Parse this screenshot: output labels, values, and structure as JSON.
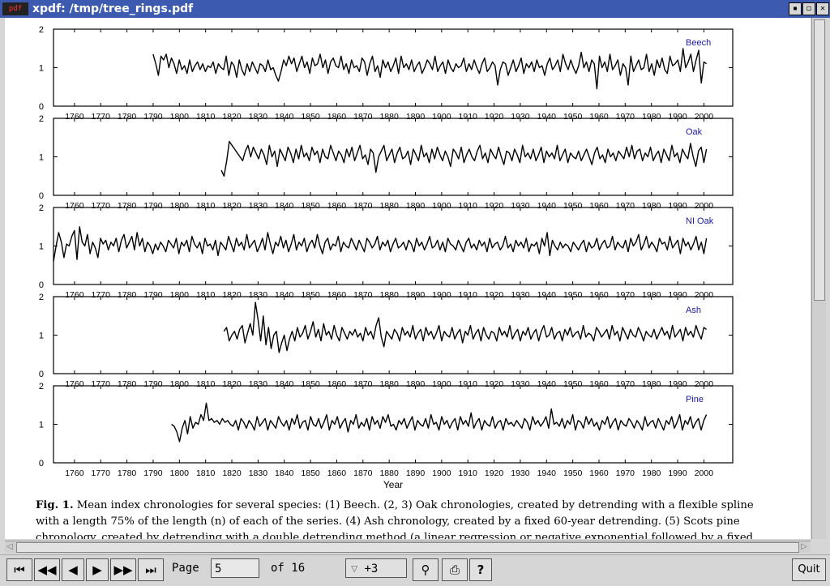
{
  "window": {
    "title": "xpdf: /tmp/tree_rings.pdf",
    "app_icon": "pdf",
    "buttons": [
      "iconify-icon",
      "maximize-icon",
      "close-icon"
    ]
  },
  "document": {
    "caption_lines": [
      "Mean index chronologies for several species: (1) Beech. (2, 3) Oak chronologies, created by detrending with a flexible spline",
      "with a length 75% of the length (n) of each of the series. (4) Ash chronology, created by a fixed 60-year detrending. (5) Scots pine",
      "chronology, created by detrending with a double detrending method (a linear regression or negative exponential followed by a fixed"
    ],
    "caption_label": "Fig. 1."
  },
  "chart_data": {
    "type": "line",
    "xlabel": "Year",
    "x_ticks": [
      1760,
      1770,
      1780,
      1790,
      1800,
      1810,
      1820,
      1830,
      1840,
      1850,
      1860,
      1870,
      1880,
      1890,
      1900,
      1910,
      1920,
      1930,
      1940,
      1950,
      1960,
      1970,
      1980,
      1990,
      2000
    ],
    "y_ticks": [
      0,
      1,
      2
    ],
    "xlim": [
      1752,
      2011
    ],
    "ylim": [
      0,
      2
    ],
    "panels": [
      {
        "name": "Beech",
        "start": 1790,
        "end": 2001,
        "values": [
          1.35,
          1.1,
          0.8,
          1.3,
          1.2,
          1.35,
          1.0,
          1.25,
          1.1,
          0.85,
          1.2,
          0.95,
          1.05,
          0.85,
          1.2,
          0.9,
          1.05,
          1.15,
          0.95,
          1.1,
          0.9,
          1.05,
          1.0,
          1.15,
          0.85,
          1.1,
          1.0,
          0.95,
          1.3,
          0.8,
          1.15,
          1.05,
          0.75,
          1.2,
          0.95,
          0.8,
          1.1,
          0.9,
          1.15,
          1.0,
          0.85,
          1.1,
          1.05,
          0.9,
          1.2,
          0.95,
          1.0,
          0.8,
          0.65,
          0.9,
          1.2,
          1.05,
          1.3,
          1.1,
          1.25,
          0.9,
          1.1,
          1.3,
          1.0,
          1.15,
          0.85,
          1.25,
          1.05,
          1.1,
          1.35,
          1.0,
          1.2,
          0.85,
          1.15,
          1.25,
          1.05,
          1.0,
          1.3,
          0.95,
          1.1,
          0.85,
          1.2,
          1.0,
          1.05,
          0.9,
          1.25,
          1.15,
          0.8,
          1.1,
          1.3,
          0.9,
          1.05,
          0.75,
          1.2,
          1.0,
          1.15,
          0.9,
          1.05,
          1.25,
          0.85,
          1.3,
          1.0,
          1.1,
          0.95,
          1.2,
          0.9,
          1.05,
          1.15,
          0.85,
          1.0,
          1.2,
          1.1,
          0.95,
          1.3,
          0.9,
          1.05,
          1.15,
          0.85,
          1.2,
          1.0,
          0.9,
          1.1,
          1.0,
          1.05,
          1.25,
          0.9,
          1.1,
          0.95,
          1.2,
          1.0,
          0.85,
          1.1,
          1.25,
          0.9,
          1.0,
          1.15,
          1.05,
          0.55,
          0.95,
          1.15,
          1.1,
          0.8,
          1.0,
          1.2,
          0.9,
          1.05,
          1.25,
          0.85,
          1.1,
          1.0,
          1.15,
          0.9,
          1.2,
          1.0,
          1.05,
          0.8,
          1.1,
          1.25,
          0.95,
          1.05,
          1.2,
          0.9,
          1.35,
          1.1,
          0.95,
          1.2,
          1.0,
          0.85,
          1.05,
          1.4,
          1.0,
          1.15,
          0.9,
          1.2,
          1.1,
          0.45,
          1.3,
          1.0,
          1.15,
          0.9,
          1.35,
          0.95,
          1.05,
          1.2,
          0.8,
          1.1,
          1.0,
          0.55,
          1.3,
          0.9,
          1.05,
          1.2,
          0.95,
          1.0,
          1.35,
          0.9,
          1.1,
          0.8,
          1.2,
          1.0,
          1.25,
          0.95,
          0.85,
          1.3,
          1.05,
          1.1,
          1.2,
          0.9,
          1.5,
          1.0,
          1.15,
          1.35,
          0.9,
          1.2,
          1.45,
          0.6,
          1.15,
          1.1
        ]
      },
      {
        "name": "Oak",
        "start": 1816,
        "end": 2001,
        "values": [
          0.65,
          0.5,
          0.9,
          1.4,
          1.3,
          1.2,
          1.1,
          1.0,
          0.9,
          1.15,
          1.3,
          1.0,
          1.25,
          1.1,
          0.95,
          1.2,
          1.05,
          0.8,
          1.3,
          1.0,
          1.15,
          0.75,
          1.2,
          1.05,
          0.9,
          1.25,
          1.1,
          0.85,
          1.2,
          0.95,
          1.3,
          1.0,
          1.1,
          0.9,
          1.25,
          1.05,
          1.15,
          0.85,
          1.2,
          1.0,
          0.95,
          1.3,
          1.1,
          0.9,
          1.15,
          1.05,
          0.85,
          1.2,
          1.0,
          1.25,
          0.9,
          1.1,
          1.3,
          0.95,
          1.05,
          0.8,
          1.2,
          1.1,
          0.6,
          1.0,
          1.15,
          1.3,
          0.9,
          1.05,
          1.2,
          0.85,
          1.1,
          1.25,
          0.95,
          1.0,
          1.15,
          0.8,
          1.2,
          1.05,
          0.9,
          1.3,
          1.0,
          1.1,
          0.85,
          1.2,
          0.95,
          1.25,
          1.05,
          0.9,
          1.15,
          1.0,
          0.75,
          1.2,
          1.1,
          0.95,
          1.25,
          0.85,
          1.05,
          1.2,
          1.0,
          0.9,
          1.15,
          1.3,
          0.95,
          1.1,
          0.85,
          1.2,
          1.05,
          0.95,
          1.25,
          1.0,
          0.8,
          1.15,
          1.1,
          0.9,
          1.2,
          1.05,
          0.85,
          1.3,
          1.0,
          1.1,
          0.95,
          1.2,
          0.9,
          1.05,
          1.25,
          0.85,
          1.15,
          1.0,
          1.1,
          0.95,
          1.3,
          0.9,
          1.05,
          1.2,
          0.85,
          1.1,
          1.0,
          0.95,
          1.15,
          0.9,
          1.05,
          1.2,
          1.0,
          0.8,
          1.1,
          1.25,
          0.95,
          1.05,
          0.85,
          1.2,
          1.0,
          1.1,
          0.9,
          1.15,
          1.05,
          0.95,
          1.25,
          1.0,
          1.3,
          0.95,
          1.15,
          1.2,
          0.9,
          1.1,
          1.0,
          1.25,
          0.9,
          1.05,
          1.15,
          0.85,
          1.2,
          1.05,
          0.9,
          1.3,
          1.0,
          1.1,
          0.85,
          1.2,
          1.05,
          0.95,
          1.35,
          1.0,
          0.75,
          1.15,
          1.25,
          0.85,
          1.2
        ]
      },
      {
        "name": "NI Oak",
        "start": 1752,
        "end": 2001,
        "values": [
          0.6,
          1.0,
          1.35,
          1.1,
          0.7,
          1.05,
          1.0,
          1.25,
          1.4,
          0.65,
          1.5,
          1.1,
          1.0,
          1.3,
          0.8,
          1.1,
          0.95,
          0.7,
          1.2,
          1.05,
          1.15,
          0.9,
          1.1,
          1.0,
          1.2,
          0.85,
          1.15,
          1.3,
          0.95,
          1.1,
          1.25,
          0.9,
          1.35,
          1.0,
          1.2,
          0.85,
          1.1,
          1.0,
          0.8,
          1.05,
          0.9,
          1.1,
          1.0,
          0.85,
          1.15,
          1.05,
          0.95,
          1.2,
          0.8,
          1.1,
          1.0,
          1.15,
          0.85,
          1.25,
          1.05,
          0.95,
          1.1,
          0.8,
          1.2,
          1.0,
          1.05,
          0.9,
          1.15,
          0.75,
          1.1,
          1.0,
          0.9,
          1.25,
          1.05,
          0.85,
          1.2,
          1.0,
          1.1,
          0.9,
          1.3,
          0.95,
          1.05,
          1.15,
          0.85,
          1.0,
          1.2,
          0.9,
          1.35,
          1.05,
          0.8,
          1.1,
          1.0,
          1.25,
          0.95,
          1.15,
          0.85,
          1.05,
          1.3,
          0.9,
          1.1,
          1.0,
          1.2,
          0.85,
          1.05,
          1.15,
          0.95,
          1.3,
          1.0,
          0.8,
          1.1,
          1.2,
          0.9,
          1.05,
          1.0,
          1.25,
          0.85,
          1.1,
          1.0,
          0.95,
          1.2,
          1.05,
          0.9,
          1.15,
          1.0,
          0.85,
          1.2,
          1.1,
          0.95,
          1.05,
          1.25,
          0.9,
          1.1,
          1.0,
          1.15,
          0.85,
          1.05,
          1.2,
          0.95,
          1.0,
          1.1,
          0.9,
          1.15,
          1.05,
          0.85,
          1.2,
          1.0,
          1.1,
          0.9,
          1.05,
          1.25,
          0.95,
          1.0,
          1.15,
          0.9,
          1.1,
          0.85,
          1.2,
          1.05,
          1.0,
          0.9,
          1.15,
          1.0,
          0.85,
          1.1,
          1.2,
          0.95,
          1.05,
          0.9,
          1.15,
          1.0,
          1.1,
          0.85,
          1.2,
          0.95,
          1.05,
          1.1,
          0.9,
          1.0,
          1.25,
          0.95,
          1.05,
          0.85,
          1.15,
          1.0,
          1.1,
          0.95,
          1.2,
          0.85,
          1.05,
          1.0,
          1.1,
          0.8,
          1.2,
          1.0,
          1.35,
          0.75,
          1.15,
          1.0,
          0.9,
          1.1,
          0.95,
          1.05,
          1.0,
          0.85,
          1.1,
          1.0,
          0.9,
          1.05,
          1.15,
          0.85,
          1.1,
          0.95,
          1.0,
          1.2,
          0.9,
          1.05,
          1.15,
          0.95,
          1.0,
          1.25,
          0.9,
          1.1,
          1.0,
          0.95,
          1.15,
          0.85,
          1.2,
          1.0,
          1.1,
          1.3,
          0.9,
          1.05,
          1.25,
          0.95,
          1.1,
          1.0,
          0.85,
          1.2,
          1.05,
          1.1,
          0.9,
          1.25,
          0.95,
          1.05,
          1.15,
          0.8,
          1.2,
          1.0,
          1.1,
          0.9,
          1.05,
          1.25,
          0.9,
          1.1,
          0.8,
          1.2
        ]
      },
      {
        "name": "Ash",
        "start": 1817,
        "end": 2001,
        "values": [
          1.1,
          1.2,
          0.85,
          1.0,
          1.1,
          0.9,
          1.15,
          1.25,
          0.8,
          1.05,
          1.3,
          1.0,
          1.85,
          1.4,
          0.85,
          1.5,
          0.75,
          1.2,
          0.65,
          1.0,
          1.1,
          0.55,
          0.8,
          1.0,
          0.6,
          0.9,
          1.1,
          0.85,
          1.2,
          0.95,
          1.05,
          1.25,
          0.9,
          1.1,
          1.35,
          0.95,
          1.15,
          0.85,
          1.3,
          1.0,
          1.1,
          0.9,
          1.25,
          1.0,
          0.85,
          1.2,
          1.05,
          0.9,
          1.1,
          1.0,
          1.15,
          0.95,
          1.05,
          0.85,
          1.2,
          1.0,
          1.1,
          0.9,
          1.25,
          1.45,
          0.95,
          0.7,
          1.1,
          1.0,
          0.9,
          1.15,
          1.05,
          0.85,
          1.2,
          1.0,
          1.1,
          0.95,
          1.25,
          0.9,
          1.05,
          1.15,
          0.85,
          1.2,
          1.0,
          1.1,
          0.9,
          1.05,
          1.25,
          0.85,
          1.1,
          1.0,
          0.95,
          1.2,
          0.9,
          1.05,
          1.15,
          0.8,
          1.1,
          1.0,
          1.25,
          0.9,
          1.05,
          1.15,
          0.85,
          1.2,
          1.0,
          0.9,
          1.1,
          1.05,
          0.85,
          1.2,
          1.0,
          1.1,
          0.95,
          1.25,
          0.9,
          1.05,
          1.15,
          0.85,
          1.1,
          1.0,
          1.2,
          0.9,
          1.05,
          1.15,
          0.85,
          1.1,
          1.25,
          0.95,
          1.0,
          1.2,
          0.9,
          1.05,
          1.1,
          0.85,
          1.15,
          1.0,
          1.2,
          0.95,
          1.05,
          1.1,
          0.9,
          1.25,
          0.95,
          1.05,
          1.0,
          0.85,
          1.2,
          1.1,
          0.95,
          1.05,
          1.15,
          0.9,
          1.25,
          1.0,
          1.1,
          0.85,
          1.2,
          1.05,
          0.9,
          1.15,
          1.0,
          0.95,
          1.2,
          1.05,
          0.85,
          1.1,
          1.0,
          0.95,
          1.15,
          0.9,
          1.05,
          1.2,
          1.0,
          1.1,
          0.9,
          1.25,
          0.95,
          1.05,
          1.15,
          0.85,
          1.2,
          1.0,
          1.1,
          0.95,
          1.25,
          1.05,
          0.9,
          1.2,
          1.15
        ]
      },
      {
        "name": "Pine",
        "start": 1797,
        "end": 2001,
        "values": [
          1.0,
          0.95,
          0.8,
          0.55,
          0.9,
          1.1,
          0.75,
          1.2,
          0.9,
          1.05,
          1.0,
          1.25,
          1.1,
          1.55,
          1.1,
          1.15,
          1.05,
          1.1,
          1.0,
          1.15,
          1.05,
          1.1,
          1.0,
          0.95,
          1.1,
          0.85,
          1.15,
          1.05,
          0.9,
          1.1,
          1.0,
          0.85,
          1.2,
          0.95,
          1.05,
          1.15,
          0.85,
          1.1,
          1.0,
          0.9,
          1.2,
          1.05,
          0.95,
          1.1,
          0.85,
          1.15,
          1.0,
          1.25,
          0.9,
          1.05,
          1.1,
          0.85,
          1.2,
          1.0,
          0.95,
          1.15,
          0.9,
          1.05,
          1.25,
          0.85,
          1.1,
          1.0,
          1.2,
          0.9,
          1.05,
          1.15,
          0.8,
          1.1,
          1.0,
          1.25,
          0.9,
          1.05,
          0.95,
          1.15,
          0.85,
          1.2,
          1.0,
          1.1,
          0.9,
          1.2,
          1.05,
          1.25,
          0.95,
          1.0,
          0.85,
          1.1,
          1.0,
          1.15,
          0.9,
          1.05,
          1.2,
          0.85,
          1.1,
          1.0,
          0.95,
          1.15,
          0.9,
          1.25,
          1.0,
          1.05,
          0.85,
          1.2,
          1.0,
          1.1,
          0.9,
          1.05,
          1.15,
          0.85,
          1.2,
          1.0,
          1.1,
          0.95,
          1.3,
          0.9,
          1.05,
          1.15,
          0.85,
          1.1,
          1.0,
          0.95,
          1.2,
          0.9,
          1.05,
          1.1,
          0.85,
          1.15,
          1.0,
          1.05,
          0.95,
          1.1,
          1.0,
          0.9,
          1.15,
          1.05,
          0.85,
          1.2,
          1.0,
          1.1,
          0.95,
          1.05,
          1.2,
          0.9,
          1.4,
          1.0,
          1.05,
          0.95,
          1.15,
          0.9,
          1.1,
          1.0,
          1.25,
          0.85,
          1.1,
          1.05,
          0.9,
          1.2,
          1.0,
          1.15,
          0.95,
          1.05,
          0.85,
          1.1,
          1.0,
          1.2,
          0.9,
          1.05,
          1.15,
          0.85,
          1.1,
          1.0,
          0.95,
          1.15,
          1.05,
          0.9,
          1.1,
          1.0,
          0.85,
          1.2,
          0.95,
          1.05,
          1.1,
          0.9,
          1.15,
          1.0,
          0.85,
          1.1,
          1.0,
          1.2,
          0.9,
          1.05,
          1.25,
          0.85,
          1.1,
          1.0,
          1.2,
          0.9,
          1.05,
          1.15,
          0.85,
          1.1,
          1.25
        ]
      }
    ],
    "label_color": "#1a1aa6",
    "line_color": "#000000"
  },
  "toolbar": {
    "page_label": "Page",
    "page_value": "5",
    "of_label": "of 16",
    "zoom_value": "+3",
    "quit_label": "Quit",
    "buttons": [
      "first-page-icon",
      "prev-page-fast-icon",
      "prev-page-icon",
      "next-page-icon",
      "next-page-fast-icon",
      "last-page-icon",
      "find-icon",
      "print-icon",
      "about-icon"
    ]
  }
}
